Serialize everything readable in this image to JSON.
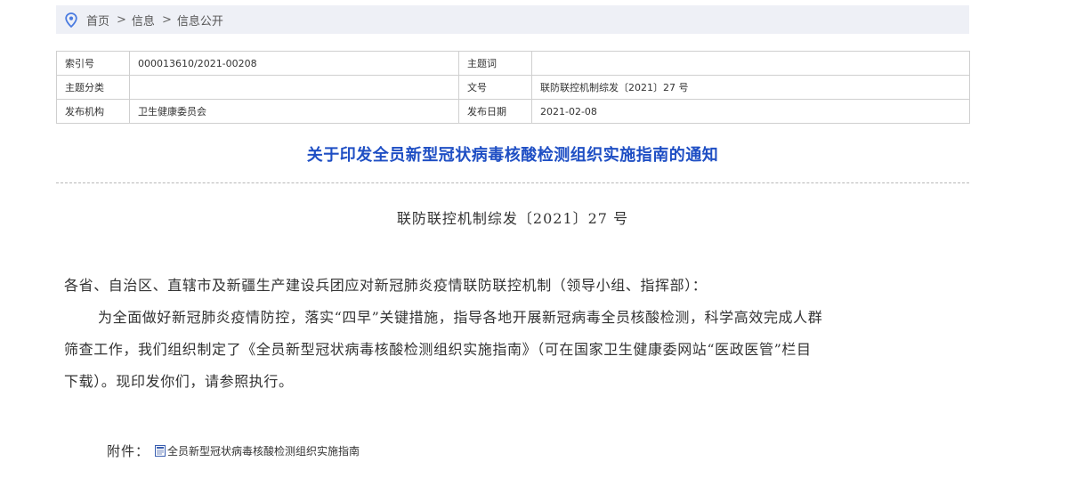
{
  "breadcrumb": {
    "items": [
      "首页",
      "信息",
      "信息公开"
    ],
    "separator": ">"
  },
  "meta": {
    "rows": [
      {
        "k1": "索引号",
        "v1": "000013610/2021-00208",
        "k2": "主题词",
        "v2": ""
      },
      {
        "k1": "主题分类",
        "v1": "",
        "k2": "文号",
        "v2": "联防联控机制综发〔2021〕27 号"
      },
      {
        "k1": "发布机构",
        "v1": "卫生健康委员会",
        "k2": "发布日期",
        "v2": "2021-02-08"
      }
    ]
  },
  "article": {
    "title": "关于印发全员新型冠状病毒核酸检测组织实施指南的通知",
    "doc_number": "联防联控机制综发〔2021〕27 号",
    "salutation": "各省、自治区、直辖市及新疆生产建设兵团应对新冠肺炎疫情联防联控机制（领导小组、指挥部）：",
    "body_line1": "为全面做好新冠肺炎疫情防控，落实“四早”关键措施，指导各地开展新冠病毒全员核酸检测，科学高效完成人群",
    "body_line2": "筛查工作，我们组织制定了《全员新型冠状病毒核酸检测组织实施指南》（可在国家卫生健康委网站“医政医管”栏目",
    "body_line3": "下载）。现印发你们，请参照执行。"
  },
  "attachment": {
    "label": "附件：",
    "file_name": "全员新型冠状病毒核酸检测组织实施指南"
  },
  "colors": {
    "title": "#1f4fc4",
    "breadcrumb_bg": "#eef0f6",
    "pin": "#4a7be0"
  }
}
